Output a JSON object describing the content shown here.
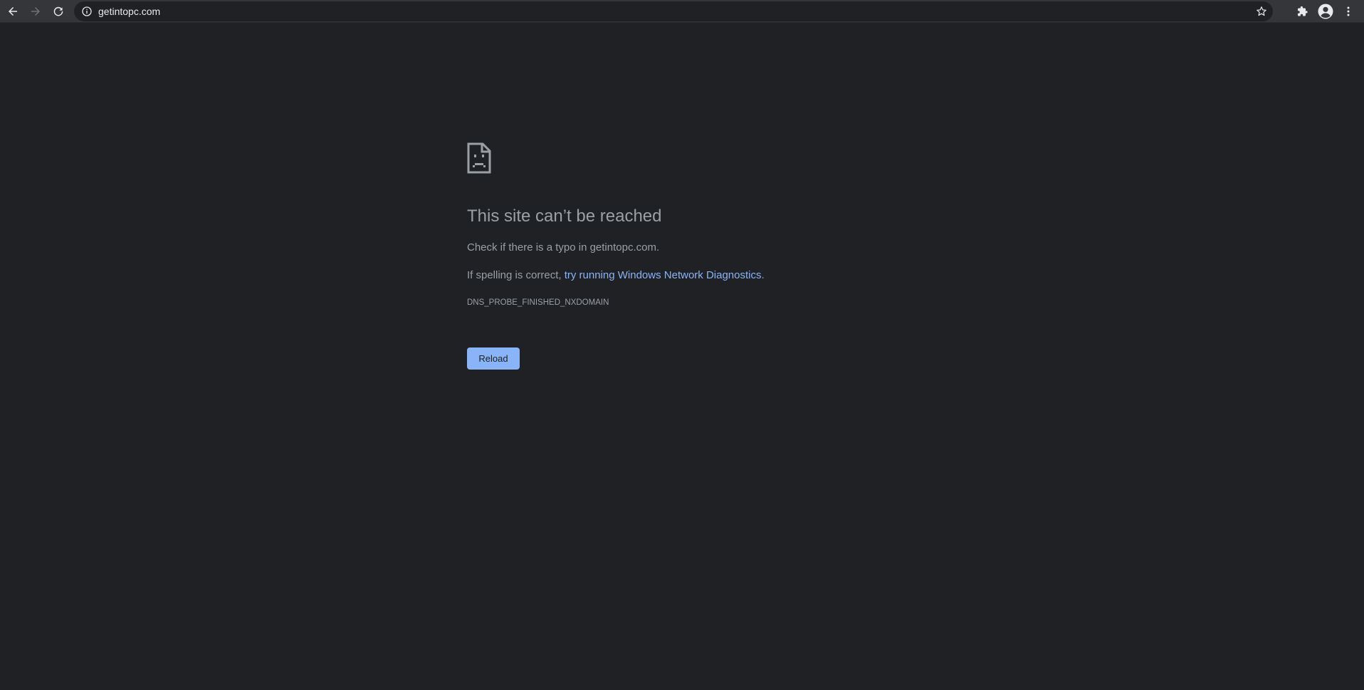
{
  "browser": {
    "back_icon": "arrow-left-icon",
    "forward_icon": "arrow-right-icon",
    "reload_icon": "reload-icon",
    "site_info_icon": "info-icon",
    "url": "getintopc.com",
    "bookmark_icon": "star-icon",
    "extensions_icon": "puzzle-icon",
    "profile_icon": "account-circle-icon",
    "menu_icon": "kebab-menu-icon"
  },
  "error_page": {
    "icon": "sad-document-icon",
    "title": "This site can’t be reached",
    "line1": "Check if there is a typo in getintopc.com.",
    "line2_prefix": "If spelling is correct, ",
    "line2_link": "try running Windows Network Diagnostics",
    "line2_suffix": ".",
    "error_code": "DNS_PROBE_FINISHED_NXDOMAIN",
    "reload_label": "Reload"
  },
  "colors": {
    "page_background": "#202124",
    "toolbar_background": "#35363a",
    "text_muted": "#9aa0a6",
    "link": "#8ab4f8",
    "button_background": "#8ab4f8"
  }
}
